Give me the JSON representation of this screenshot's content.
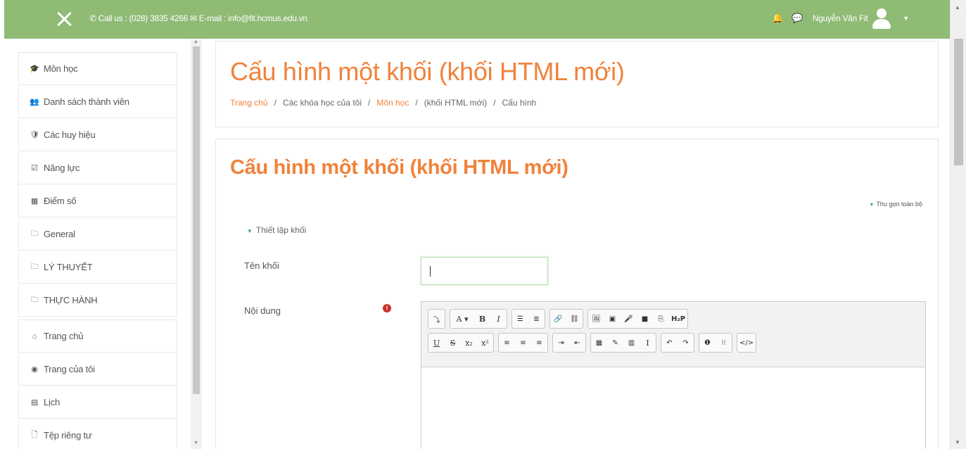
{
  "topbar": {
    "contact": "Call us : (028) 3835 4266",
    "email": "E-mail : info@fit.hcmus.edu.vn",
    "user_name": "Nguyễn Văn Fit"
  },
  "sidebar": {
    "items": [
      {
        "label": "Môn học",
        "icon": "graduation-cap-icon",
        "glyph": "🎓"
      },
      {
        "label": "Danh sách thành viên",
        "icon": "users-icon",
        "glyph": "👥"
      },
      {
        "label": "Các huy hiệu",
        "icon": "shield-icon",
        "glyph": "🛡"
      },
      {
        "label": "Năng lực",
        "icon": "checkbox-icon",
        "glyph": "☑"
      },
      {
        "label": "Điểm số",
        "icon": "table-icon",
        "glyph": "▦"
      },
      {
        "label": "General",
        "icon": "folder-icon",
        "glyph": "🗀"
      },
      {
        "label": "LÝ THUYẾT",
        "icon": "folder-icon",
        "glyph": "🗀"
      },
      {
        "label": "THỰC HÀNH",
        "icon": "folder-icon",
        "glyph": "🗀"
      },
      {
        "label": "Trang chủ",
        "icon": "home-icon",
        "glyph": "⌂"
      },
      {
        "label": "Trang của tôi",
        "icon": "dashboard-icon",
        "glyph": "◉"
      },
      {
        "label": "Lịch",
        "icon": "calendar-icon",
        "glyph": "▤"
      },
      {
        "label": "Tệp riêng tư",
        "icon": "file-icon",
        "glyph": "🗋"
      }
    ]
  },
  "header": {
    "title": "Cấu hình một khối (khối HTML mới)",
    "breadcrumb": {
      "home": "Trang chủ",
      "my_courses": "Các khóa học của tôi",
      "course": "Môn học",
      "block": "(khối HTML mới)",
      "config": "Cấu hình"
    }
  },
  "form": {
    "title": "Cấu hình một khối (khối HTML mới)",
    "collapse_all": "Thu gọn toàn bộ",
    "section": "Thiết lập khối",
    "name_label": "Tên khối",
    "name_value": "",
    "content_label": "Nội dung",
    "required_mark": "!"
  },
  "editor": {
    "row1": [
      "⤵",
      "A ▾",
      "B",
      "I",
      "☰",
      "≣",
      "🔗",
      "⛓",
      "🖼",
      "▣",
      "🎤",
      "■",
      "⎘",
      "H₂P"
    ],
    "row2": [
      "U",
      "S",
      "x₂",
      "x²",
      "≡",
      "≡",
      "≡",
      "⇥",
      "⇤",
      "▦",
      "✎",
      "▥",
      "Ⅰ",
      "↶",
      "↷",
      "❶",
      "⁝⁝",
      "</>"
    ]
  },
  "colors": {
    "topbar_bg": "#8fbb75",
    "accent_orange": "#f0823a",
    "toggle_green": "#3aa65a",
    "required_red": "#c9302c"
  }
}
